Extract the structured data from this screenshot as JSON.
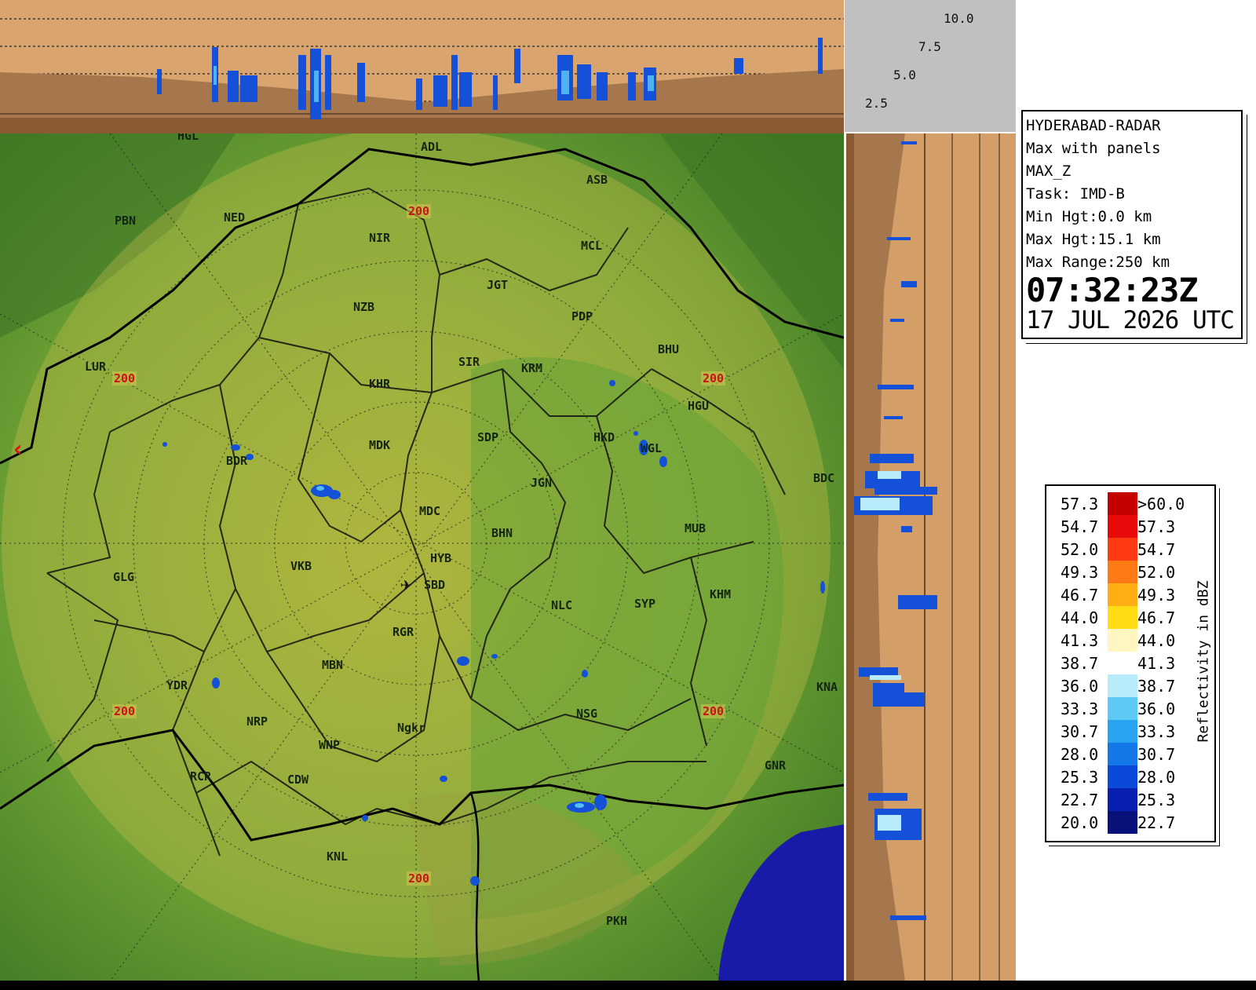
{
  "info": {
    "station": "HYDERABAD-RADAR",
    "product": "Max with panels",
    "field": "MAX_Z",
    "task": "Task: IMD-B",
    "min_hgt": "Min Hgt:0.0 km",
    "max_hgt": "Max Hgt:15.1 km",
    "max_range": "Max Range:250 km",
    "time": "07:32:23Z",
    "date": "17 JUL 2026 UTC"
  },
  "height_axis": [
    "10.0",
    "7.5",
    "5.0",
    "2.5"
  ],
  "legend": {
    "title": "Reflectivity in dBZ",
    "rows": [
      {
        "lo": "57.3",
        "hi": ">60.0",
        "color": "#c40000"
      },
      {
        "lo": "54.7",
        "hi": "57.3",
        "color": "#e80a0a"
      },
      {
        "lo": "52.0",
        "hi": "54.7",
        "color": "#ff3a12"
      },
      {
        "lo": "49.3",
        "hi": "52.0",
        "color": "#ff7a14"
      },
      {
        "lo": "46.7",
        "hi": "49.3",
        "color": "#ffae14"
      },
      {
        "lo": "44.0",
        "hi": "46.7",
        "color": "#ffdc14"
      },
      {
        "lo": "41.3",
        "hi": "44.0",
        "color": "#fff6c2"
      },
      {
        "lo": "38.7",
        "hi": "41.3",
        "color": "#ffffff"
      },
      {
        "lo": "36.0",
        "hi": "38.7",
        "color": "#b8ecfa"
      },
      {
        "lo": "33.3",
        "hi": "36.0",
        "color": "#5ccaf5"
      },
      {
        "lo": "30.7",
        "hi": "33.3",
        "color": "#2aa4f0"
      },
      {
        "lo": "28.0",
        "hi": "30.7",
        "color": "#1478e8"
      },
      {
        "lo": "25.3",
        "hi": "28.0",
        "color": "#0a48d8"
      },
      {
        "lo": "22.7",
        "hi": "25.3",
        "color": "#0820b0"
      },
      {
        "lo": "20.0",
        "hi": "22.7",
        "color": "#08107a"
      }
    ]
  },
  "range_rings_label": "200",
  "stations": [
    {
      "name": "HGL"
    },
    {
      "name": "ADL"
    },
    {
      "name": "ASB"
    },
    {
      "name": "PBN"
    },
    {
      "name": "NED"
    },
    {
      "name": "NIR"
    },
    {
      "name": "MCL"
    },
    {
      "name": "NZB"
    },
    {
      "name": "JGT"
    },
    {
      "name": "PDP"
    },
    {
      "name": "LUR"
    },
    {
      "name": "SIR"
    },
    {
      "name": "KRM"
    },
    {
      "name": "BHU"
    },
    {
      "name": "KHR"
    },
    {
      "name": "HGU"
    },
    {
      "name": "MDK"
    },
    {
      "name": "SDP"
    },
    {
      "name": "HKD"
    },
    {
      "name": "WGL"
    },
    {
      "name": "BDR"
    },
    {
      "name": "JGN"
    },
    {
      "name": "BDC"
    },
    {
      "name": "MDC"
    },
    {
      "name": "BHN"
    },
    {
      "name": "MUB"
    },
    {
      "name": "GLG"
    },
    {
      "name": "VKB"
    },
    {
      "name": "HYB"
    },
    {
      "name": "SBD"
    },
    {
      "name": "KHM"
    },
    {
      "name": "NLC"
    },
    {
      "name": "SYP"
    },
    {
      "name": "RGR"
    },
    {
      "name": "MBN"
    },
    {
      "name": "YDR"
    },
    {
      "name": "KNA"
    },
    {
      "name": "NRP"
    },
    {
      "name": "NSG"
    },
    {
      "name": "Ngkr"
    },
    {
      "name": "WNP"
    },
    {
      "name": "GNR"
    },
    {
      "name": "RCR"
    },
    {
      "name": "CDW"
    },
    {
      "name": "KNL"
    },
    {
      "name": "PKH"
    }
  ],
  "colors": {
    "panel_tan": "#d9a46e",
    "map_green": "#5c9a30",
    "coverage_yellow": "#bdb63a",
    "sea_blue": "#1a1aa8"
  }
}
